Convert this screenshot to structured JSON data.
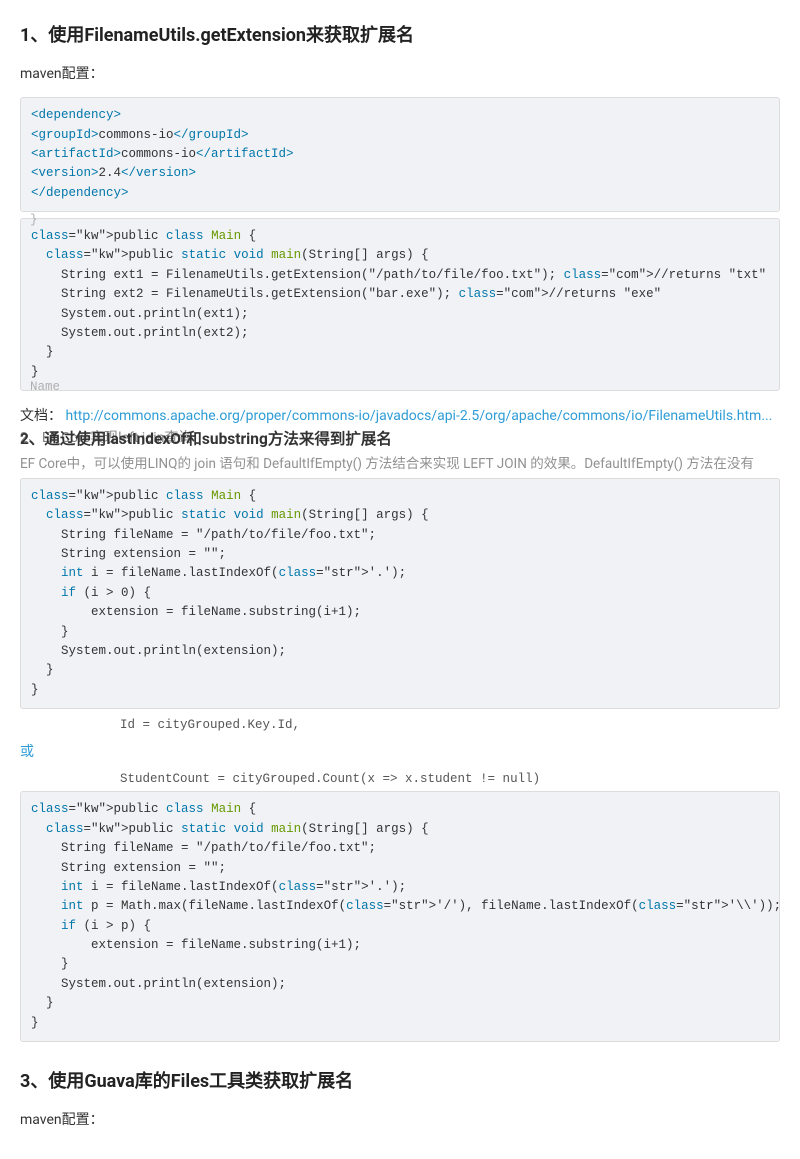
{
  "section1": {
    "heading": "1、使用FilenameUtils.getExtension来获取扩展名",
    "maven_label": "maven配置：",
    "doc_prefix": "文档：",
    "doc_url": "http://commons.apache.org/proper/commons-io/javadocs/api-2.5/org/apache/commons/io/FilenameUtils.htm...",
    "ghost_top": "}",
    "ghost_bottom": "Name"
  },
  "overlay1": {
    "behind": "2、EF Core实现left join查询",
    "front": "2、通过使用lastIndexOf和substring方法来得到扩展名",
    "below": "EF Core中，可以使用LINQ的 join 语句和 DefaultIfEmpty() 方法结合来实现 LEFT JOIN 的效果。DefaultIfEmpty() 方法在没有"
  },
  "or_text": "或",
  "float1": "Id = cityGrouped.Key.Id,",
  "float2": "StudentCount = cityGrouped.Count(x => x.student != null)",
  "section3": {
    "heading": "3、使用Guava库的Files工具类获取扩展名",
    "maven_label": "maven配置："
  },
  "code": {
    "maven": [
      {
        "t": "tag",
        "v": "<dependency>"
      },
      {
        "t": "nl"
      },
      {
        "t": "tag",
        "v": "<groupId>"
      },
      {
        "t": "txt",
        "v": "commons-io"
      },
      {
        "t": "tag",
        "v": "</groupId>"
      },
      {
        "t": "nl"
      },
      {
        "t": "tag",
        "v": "<artifactId>"
      },
      {
        "t": "txt",
        "v": "commons-io"
      },
      {
        "t": "tag",
        "v": "</artifactId>"
      },
      {
        "t": "nl"
      },
      {
        "t": "tag",
        "v": "<version>"
      },
      {
        "t": "txt",
        "v": "2.4"
      },
      {
        "t": "tag",
        "v": "</version>"
      },
      {
        "t": "nl"
      },
      {
        "t": "tag",
        "v": "</dependency>"
      }
    ],
    "java1": "public class Main {\n  public static void main(String[] args) {\n    String ext1 = FilenameUtils.getExtension(\"/path/to/file/foo.txt\"); //returns \"txt\"\n    String ext2 = FilenameUtils.getExtension(\"bar.exe\"); //returns \"exe\"\n    System.out.println(ext1);\n    System.out.println(ext2);\n  }\n}",
    "java2": "public class Main {\n  public static void main(String[] args) {\n    String fileName = \"/path/to/file/foo.txt\";\n    String extension = \"\";\n    int i = fileName.lastIndexOf('.');\n    if (i > 0) {\n        extension = fileName.substring(i+1);\n    }\n    System.out.println(extension);\n  }\n}",
    "java3": "public class Main {\n  public static void main(String[] args) {\n    String fileName = \"/path/to/file/foo.txt\";\n    String extension = \"\";\n    int i = fileName.lastIndexOf('.');\n    int p = Math.max(fileName.lastIndexOf('/'), fileName.lastIndexOf('\\\\'));\n    if (i > p) {\n        extension = fileName.substring(i+1);\n    }\n    System.out.println(extension);\n  }\n}"
  }
}
